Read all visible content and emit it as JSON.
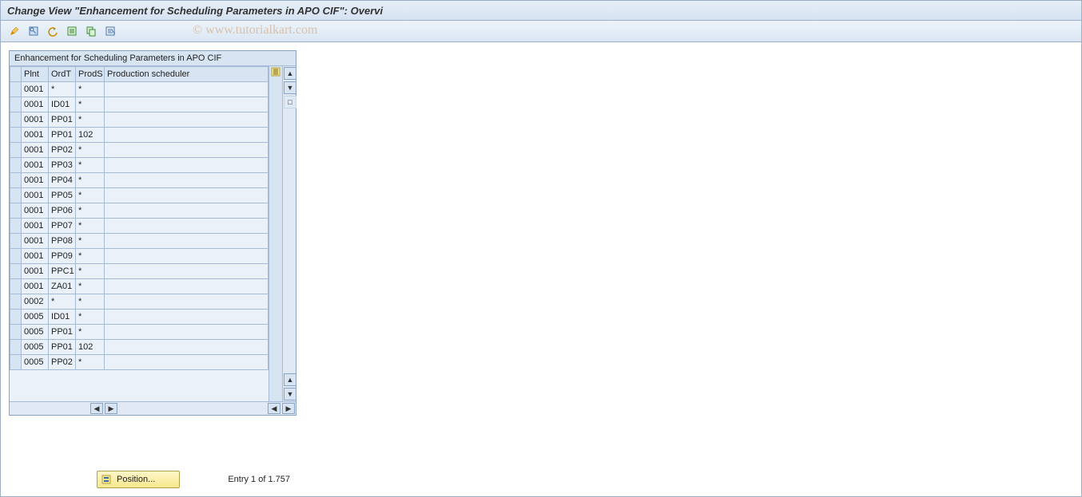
{
  "title": "Change View \"Enhancement for Scheduling Parameters in APO CIF\": Overvi",
  "watermark": "© www.tutorialkart.com",
  "panel": {
    "title": "Enhancement for Scheduling Parameters in APO CIF",
    "columns": [
      "Plnt",
      "OrdT",
      "ProdS",
      "Production scheduler"
    ],
    "rows": [
      {
        "plnt": "0001",
        "ordt": "*",
        "prods": "*",
        "sched": ""
      },
      {
        "plnt": "0001",
        "ordt": "ID01",
        "prods": "*",
        "sched": ""
      },
      {
        "plnt": "0001",
        "ordt": "PP01",
        "prods": "*",
        "sched": ""
      },
      {
        "plnt": "0001",
        "ordt": "PP01",
        "prods": "102",
        "sched": ""
      },
      {
        "plnt": "0001",
        "ordt": "PP02",
        "prods": "*",
        "sched": ""
      },
      {
        "plnt": "0001",
        "ordt": "PP03",
        "prods": "*",
        "sched": ""
      },
      {
        "plnt": "0001",
        "ordt": "PP04",
        "prods": "*",
        "sched": ""
      },
      {
        "plnt": "0001",
        "ordt": "PP05",
        "prods": "*",
        "sched": ""
      },
      {
        "plnt": "0001",
        "ordt": "PP06",
        "prods": "*",
        "sched": ""
      },
      {
        "plnt": "0001",
        "ordt": "PP07",
        "prods": "*",
        "sched": ""
      },
      {
        "plnt": "0001",
        "ordt": "PP08",
        "prods": "*",
        "sched": ""
      },
      {
        "plnt": "0001",
        "ordt": "PP09",
        "prods": "*",
        "sched": ""
      },
      {
        "plnt": "0001",
        "ordt": "PPC1",
        "prods": "*",
        "sched": ""
      },
      {
        "plnt": "0001",
        "ordt": "ZA01",
        "prods": "*",
        "sched": ""
      },
      {
        "plnt": "0002",
        "ordt": "*",
        "prods": "*",
        "sched": ""
      },
      {
        "plnt": "0005",
        "ordt": "ID01",
        "prods": "*",
        "sched": ""
      },
      {
        "plnt": "0005",
        "ordt": "PP01",
        "prods": "*",
        "sched": ""
      },
      {
        "plnt": "0005",
        "ordt": "PP01",
        "prods": "102",
        "sched": ""
      },
      {
        "plnt": "0005",
        "ordt": "PP02",
        "prods": "*",
        "sched": ""
      }
    ]
  },
  "footer": {
    "position_label": "Position...",
    "entry_text": "Entry 1 of 1.757"
  },
  "toolbar_icons": [
    "change-icon",
    "details-icon",
    "undo-icon",
    "new-entries-icon",
    "copy-icon",
    "delete-icon"
  ]
}
